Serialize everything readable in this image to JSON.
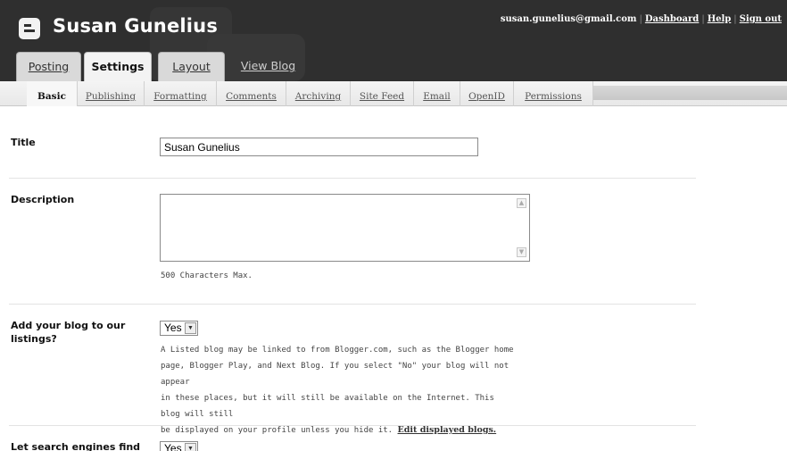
{
  "header": {
    "blog_title": "Susan Gunelius",
    "user_email": "susan.gunelius@gmail.com",
    "links": [
      "Dashboard",
      "Help",
      "Sign out"
    ],
    "separator": "|",
    "logo_icon": "blogger-logo-icon",
    "background_color": "#2f2f2f"
  },
  "tabs": [
    {
      "label": "Posting"
    },
    {
      "label": "Settings",
      "active": true
    },
    {
      "label": "Layout"
    },
    {
      "label": "View Blog"
    }
  ],
  "subtabs": [
    {
      "label": "Basic",
      "active": true
    },
    {
      "label": "Publishing"
    },
    {
      "label": "Formatting"
    },
    {
      "label": "Comments"
    },
    {
      "label": "Archiving"
    },
    {
      "label": "Site Feed"
    },
    {
      "label": "Email"
    },
    {
      "label": "OpenID"
    },
    {
      "label": "Permissions"
    }
  ],
  "form": {
    "title": {
      "label": "Title",
      "value": "Susan Gunelius"
    },
    "description": {
      "label": "Description",
      "value": "",
      "hint": "500 Characters Max."
    },
    "listing": {
      "label": "Add your blog to our listings?",
      "value": "Yes",
      "desc_lines": [
        "A Listed blog may be linked to from Blogger.com, such as the Blogger home",
        "page, Blogger Play, and Next Blog. If you select \"No\" your blog will not appear",
        "in these places, but it will still be available on the Internet. This blog will still",
        "be displayed on your profile unless you hide it."
      ],
      "link": "Edit displayed blogs."
    },
    "search": {
      "label": "Let search engines find",
      "value": "Yes"
    }
  }
}
